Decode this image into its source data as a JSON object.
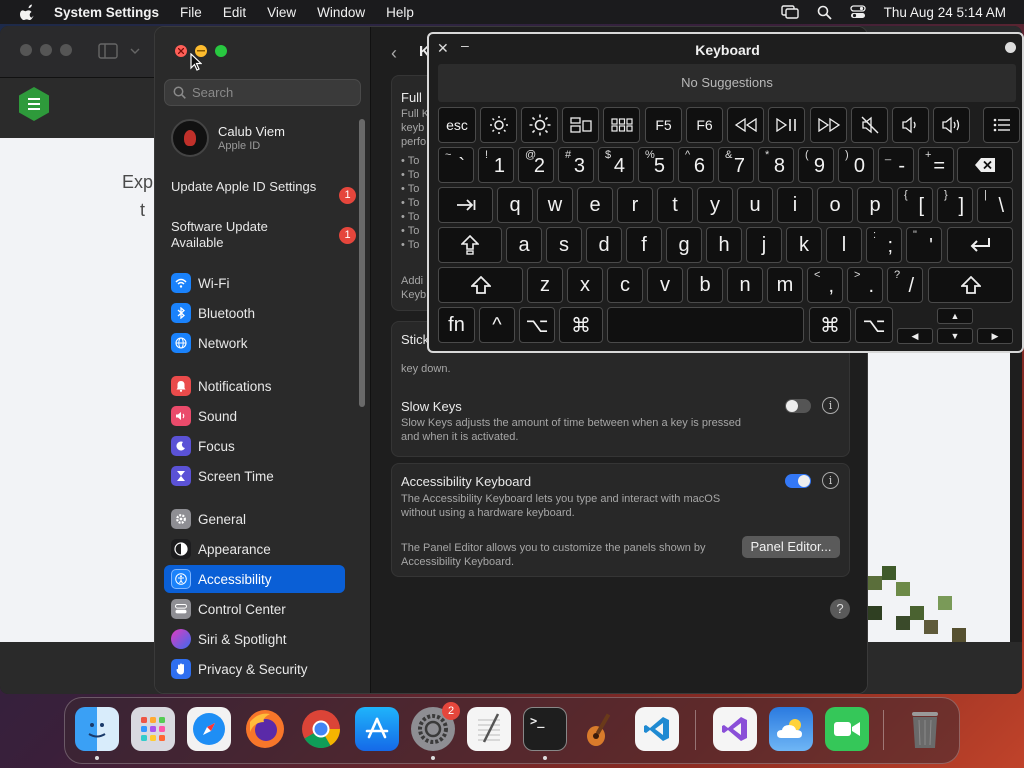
{
  "menubar": {
    "app": "System Settings",
    "items": [
      "File",
      "Edit",
      "View",
      "Window",
      "Help"
    ],
    "clock": "Thu Aug 24  5:14 AM"
  },
  "background_window": {
    "text_line1": "Exp",
    "text_line2": "t"
  },
  "settings": {
    "search_placeholder": "Search",
    "account": {
      "name": "Calub Viem",
      "sub": "Apple ID"
    },
    "notices": [
      {
        "label": "Update Apple ID Settings",
        "badge": "1"
      },
      {
        "label": "Software Update Available",
        "badge": "1"
      }
    ],
    "nav": [
      {
        "label": "Wi-Fi",
        "icon": "wifi-icon",
        "color": "#1a82fb"
      },
      {
        "label": "Bluetooth",
        "icon": "bluetooth-icon",
        "color": "#1a82fb"
      },
      {
        "label": "Network",
        "icon": "globe-icon",
        "color": "#1a82fb"
      },
      {
        "label": "Notifications",
        "icon": "bell-icon",
        "color": "#ea4b4b"
      },
      {
        "label": "Sound",
        "icon": "speaker-icon",
        "color": "#ea4b6b"
      },
      {
        "label": "Focus",
        "icon": "moon-icon",
        "color": "#5b52d6"
      },
      {
        "label": "Screen Time",
        "icon": "hourglass-icon",
        "color": "#5b52d6"
      },
      {
        "label": "General",
        "icon": "gear-icon",
        "color": "#8e8e93"
      },
      {
        "label": "Appearance",
        "icon": "appearance-icon",
        "color": "#1c1c1e"
      },
      {
        "label": "Accessibility",
        "icon": "accessibility-icon",
        "color": "#1a82fb"
      },
      {
        "label": "Control Center",
        "icon": "control-center-icon",
        "color": "#8e8e93"
      },
      {
        "label": "Siri & Spotlight",
        "icon": "siri-icon",
        "color": "#c43cd1"
      },
      {
        "label": "Privacy & Security",
        "icon": "hand-icon",
        "color": "#2f6ff0"
      }
    ],
    "main": {
      "title_partial": "K",
      "card1_title": "Full",
      "card1_desc": [
        "Full K",
        "keyb",
        "perfo"
      ],
      "card1_bullets": [
        "• To",
        "• To",
        "• To",
        "• To",
        "• To",
        "• To",
        "• To"
      ],
      "card1_footer": [
        "Addi",
        "Keyb"
      ],
      "sticky_title": "Sticky",
      "sticky_desc": "Sticky Keys allows modifier keys to be set without having to hold the key down.",
      "sticky_tail": "key down.",
      "slow_title": "Slow Keys",
      "slow_desc1": "Slow Keys adjusts the amount of time between when a key is pressed",
      "slow_desc2": "and when it is activated.",
      "slow_enabled": false,
      "acc_title": "Accessibility Keyboard",
      "acc_desc1": "The Accessibility Keyboard lets you type and interact with macOS",
      "acc_desc2": "without using a hardware keyboard.",
      "acc_enabled": true,
      "panel_desc1": "The Panel Editor allows you to customize the panels shown by",
      "panel_desc2": "Accessibility Keyboard.",
      "panel_button": "Panel Editor...",
      "help": "?"
    }
  },
  "keyboard": {
    "title": "Keyboard",
    "suggestions": "No Suggestions",
    "fn_row": [
      "esc",
      "☼",
      "☀",
      "",
      "",
      "F5",
      "F6",
      "",
      "",
      "",
      "",
      "",
      "",
      ""
    ],
    "num_row": [
      {
        "shift": "~",
        "base": "`"
      },
      {
        "shift": "!",
        "base": "1"
      },
      {
        "shift": "@",
        "base": "2"
      },
      {
        "shift": "#",
        "base": "3"
      },
      {
        "shift": "$",
        "base": "4"
      },
      {
        "shift": "%",
        "base": "5"
      },
      {
        "shift": "^",
        "base": "6"
      },
      {
        "shift": "&",
        "base": "7"
      },
      {
        "shift": "*",
        "base": "8"
      },
      {
        "shift": "(",
        "base": "9"
      },
      {
        "shift": ")",
        "base": "0"
      },
      {
        "shift": "_",
        "base": "-"
      },
      {
        "shift": "+",
        "base": "="
      }
    ],
    "row_q": [
      "q",
      "w",
      "e",
      "r",
      "t",
      "y",
      "u",
      "i",
      "o",
      "p"
    ],
    "row_q_sym": [
      {
        "shift": "{",
        "base": "["
      },
      {
        "shift": "}",
        "base": "]"
      },
      {
        "shift": "|",
        "base": "\\"
      }
    ],
    "row_a": [
      "a",
      "s",
      "d",
      "f",
      "g",
      "h",
      "j",
      "k",
      "l"
    ],
    "row_a_sym": [
      {
        "shift": ":",
        "base": ";"
      },
      {
        "shift": "\"",
        "base": "'"
      }
    ],
    "row_z": [
      "z",
      "x",
      "c",
      "v",
      "b",
      "n",
      "m"
    ],
    "row_z_sym": [
      {
        "shift": "<",
        "base": ","
      },
      {
        "shift": ">",
        "base": "."
      },
      {
        "shift": "?",
        "base": "/"
      }
    ],
    "bottom": {
      "fn": "fn",
      "ctrl": "^",
      "opt": "⌥",
      "cmd": "⌘"
    }
  }
}
